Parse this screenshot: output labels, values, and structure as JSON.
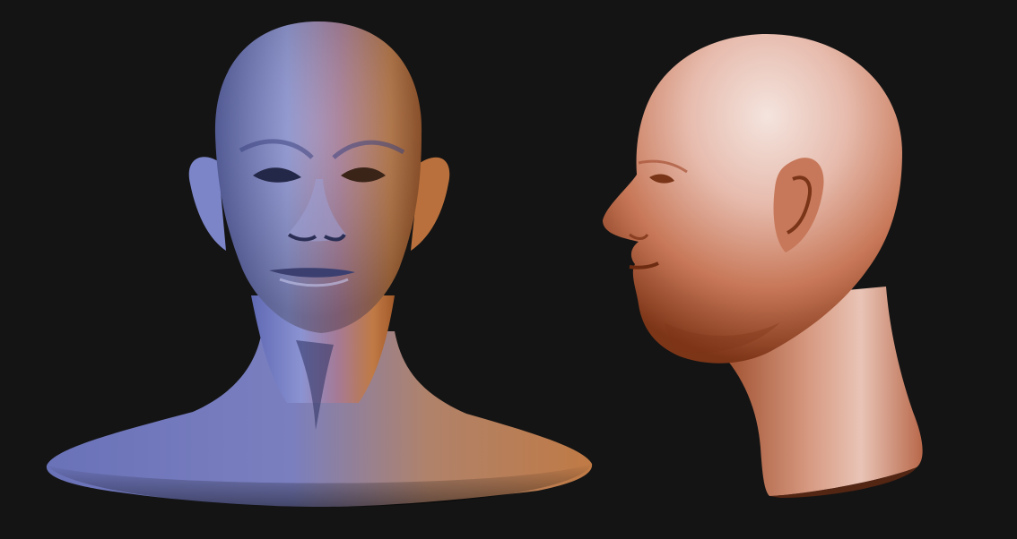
{
  "scene": {
    "background_color": "#141414",
    "render_style": "3d-sculpt-render",
    "objects": [
      {
        "name": "front-view-bust",
        "view": "front",
        "material": "matcap-blue-orange",
        "colors": {
          "cool": "#6f7bc2",
          "warm": "#c77a3c",
          "shadow": "#2a2e55"
        }
      },
      {
        "name": "side-view-head",
        "view": "profile-left",
        "material": "matcap-skin",
        "colors": {
          "light": "#f2ddd6",
          "mid": "#d9967f",
          "dark": "#8a3f22"
        }
      }
    ]
  }
}
